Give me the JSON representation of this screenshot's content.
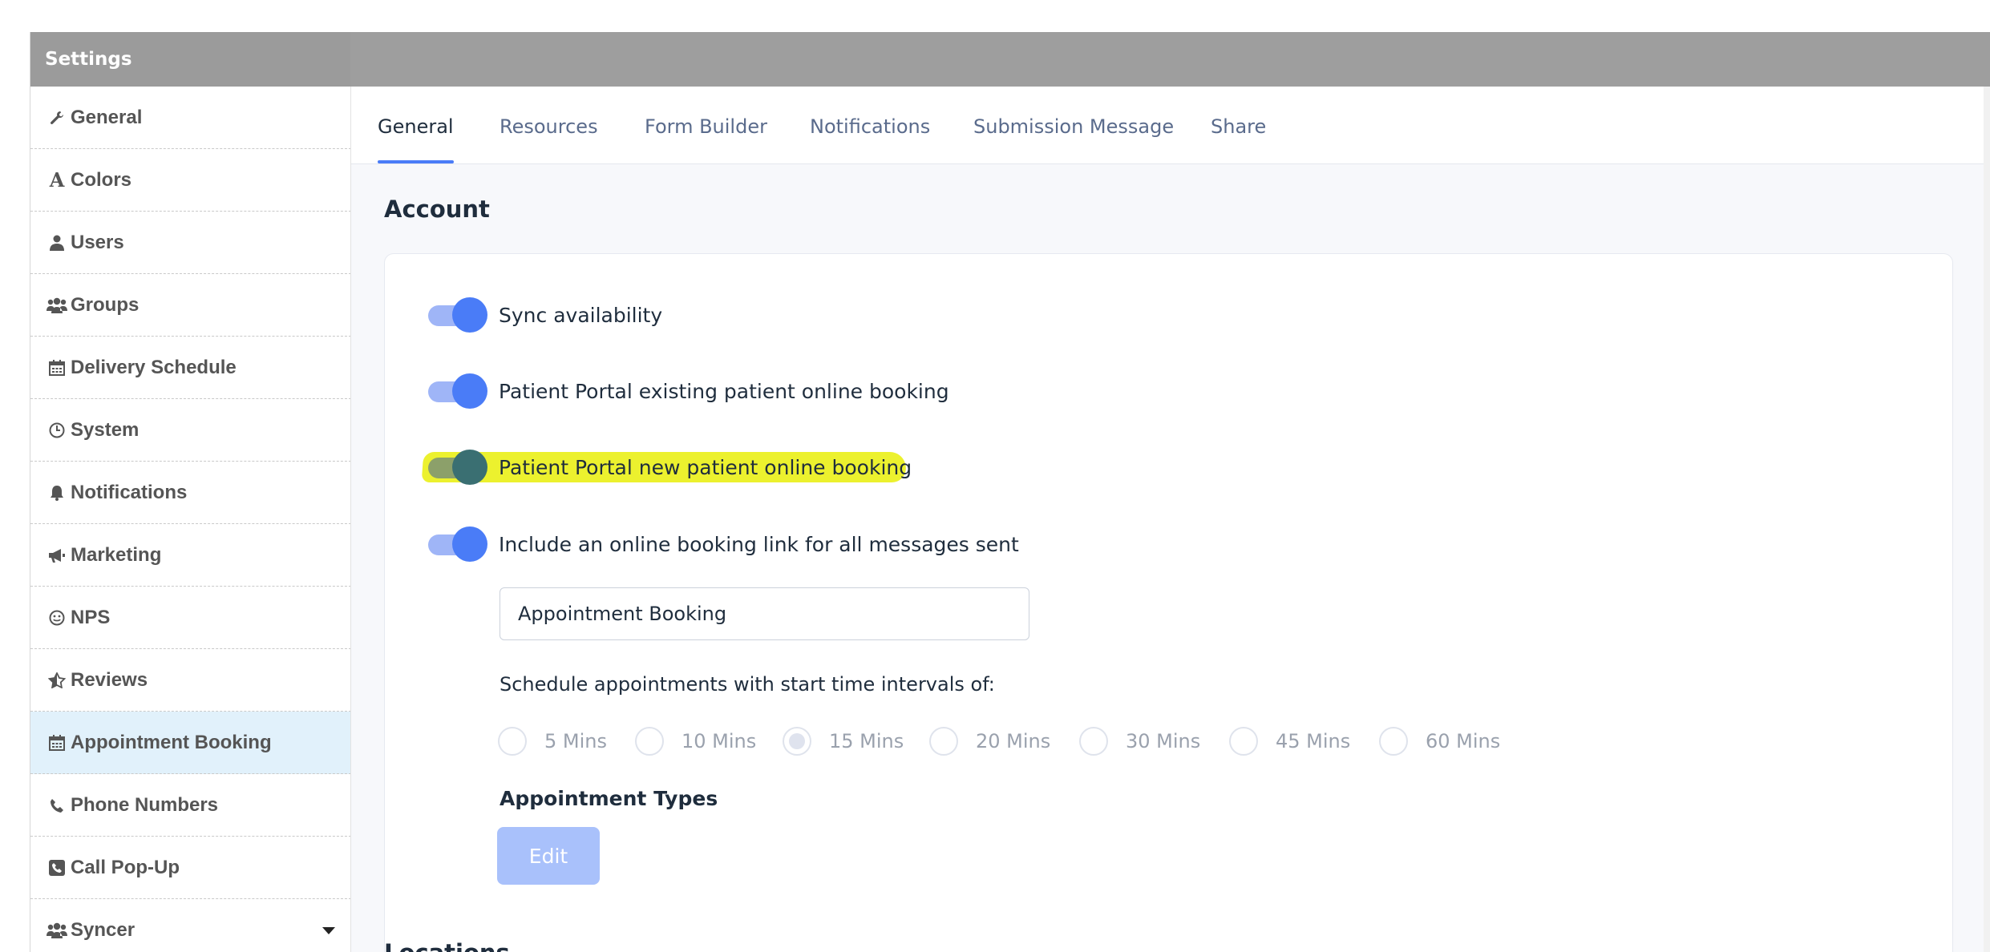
{
  "sidebar": {
    "header": "Settings",
    "items": [
      {
        "label": "General",
        "icon": "wrench-icon"
      },
      {
        "label": "Colors",
        "icon": "font-icon"
      },
      {
        "label": "Users",
        "icon": "user-icon"
      },
      {
        "label": "Groups",
        "icon": "users-icon"
      },
      {
        "label": "Delivery Schedule",
        "icon": "calendar-icon"
      },
      {
        "label": "System",
        "icon": "clock-icon"
      },
      {
        "label": "Notifications",
        "icon": "bell-icon"
      },
      {
        "label": "Marketing",
        "icon": "megaphone-icon"
      },
      {
        "label": "NPS",
        "icon": "smile-icon"
      },
      {
        "label": "Reviews",
        "icon": "star-half-icon"
      },
      {
        "label": "Appointment Booking",
        "icon": "calendar-icon",
        "active": true
      },
      {
        "label": "Phone Numbers",
        "icon": "phone-icon"
      },
      {
        "label": "Call Pop-Up",
        "icon": "phone-square-icon"
      },
      {
        "label": "Syncer",
        "icon": "users-icon"
      }
    ],
    "caret_icon": "caret-down-icon"
  },
  "tabs": [
    {
      "label": "General",
      "active": true
    },
    {
      "label": "Resources"
    },
    {
      "label": "Form Builder"
    },
    {
      "label": "Notifications"
    },
    {
      "label": "Submission Message"
    },
    {
      "label": "Share"
    }
  ],
  "account": {
    "title": "Account",
    "toggles": [
      {
        "label": "Sync availability",
        "on": true
      },
      {
        "label": "Patient Portal existing patient online booking",
        "on": true
      },
      {
        "label": "Patient Portal new patient online booking",
        "on": true,
        "highlighted": true
      },
      {
        "label": "Include an online booking link for all messages sent",
        "on": true
      }
    ],
    "booking_link_text": "Appointment Booking",
    "interval_label": "Schedule appointments with start time intervals of:",
    "intervals": [
      {
        "label": "5 Mins",
        "selected": false
      },
      {
        "label": "10 Mins",
        "selected": false
      },
      {
        "label": "15 Mins",
        "selected": true
      },
      {
        "label": "20 Mins",
        "selected": false
      },
      {
        "label": "30 Mins",
        "selected": false
      },
      {
        "label": "45 Mins",
        "selected": false
      },
      {
        "label": "60 Mins",
        "selected": false
      }
    ],
    "types_label": "Appointment Types",
    "edit_label": "Edit"
  },
  "next_section_title": "Locations",
  "colors": {
    "accent": "#4a7cf7",
    "toggle_track": "#9fb5f7",
    "sidebar_header": "#9b9b9b",
    "active_item_bg": "#e1f1fb",
    "highlight": "#e8ee00",
    "button_disabled": "#a9c1fb"
  }
}
